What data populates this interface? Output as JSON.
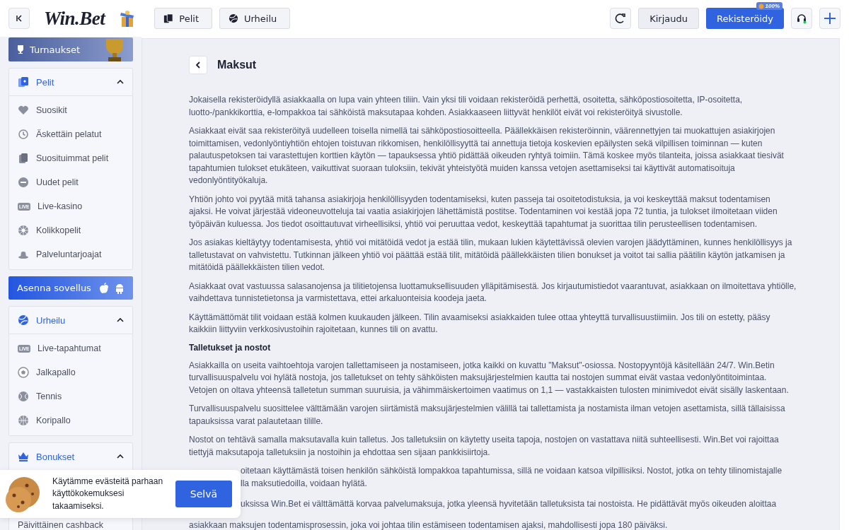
{
  "header": {
    "logo": "Win.Bet",
    "nav": [
      {
        "label": "Pelit"
      },
      {
        "label": "Urheilu"
      }
    ],
    "login": "Kirjaudu",
    "register": "Rekisteröidy",
    "register_badge": "100%"
  },
  "sidebar": {
    "promo": "Turnaukset",
    "sections": [
      {
        "title": "Pelit",
        "expanded": true,
        "items": [
          {
            "label": "Suosikit"
          },
          {
            "label": "Äskettäin pelatut"
          },
          {
            "label": "Suosituimmat pelit"
          },
          {
            "label": "Uudet pelit"
          },
          {
            "label": "Live-kasino",
            "badge": "LIVE"
          },
          {
            "label": "Kolikkopelit"
          },
          {
            "label": "Palveluntarjoajat"
          }
        ]
      },
      {
        "title": "Urheilu",
        "expanded": true,
        "items": [
          {
            "label": "Live-tapahtumat",
            "badge": "LIVE"
          },
          {
            "label": "Jalkapallo"
          },
          {
            "label": "Tennis"
          },
          {
            "label": "Koripallo"
          }
        ]
      },
      {
        "title": "Bonukset",
        "expanded": true,
        "items": [
          {
            "label": "Päivittäinen cashback"
          }
        ]
      }
    ],
    "install": "Asenna sovellus"
  },
  "main": {
    "title": "Maksut",
    "blocks": [
      {
        "kind": "paragraph",
        "text": "Jokaisella rekisteröidyllä asiakkaalla on lupa vain yhteen tiliin. Vain yksi tili voidaan rekisteröidä perhettä, osoitetta, sähköpostiosoitetta, IP-osoitetta, luotto-/pankkikorttia, e-lompakkoa tai sähköistä maksutapaa kohden. Asiakkaaseen liittyvät henkilöt eivät voi rekisteröityä sivustolle."
      },
      {
        "kind": "paragraph",
        "text": "Asiakkaat eivät saa rekisteröityä uudelleen toisella nimellä tai sähköpostiosoitteella. Päällekkäisen rekisteröinnin, väärennettyjen tai muokattujen asiakirjojen toimittamisen, vedonlyöntiyhtiön ehtojen toistuvan rikkomisen, henkilöllisyyttä tai annettuja tietoja koskevien epäilysten sekä vilpillisen toiminnan — kuten palautuspetoksen tai varastettujen korttien käytön — tapauksessa yhtiö pidättää oikeuden ryhtyä toimiin. Tämä koskee myös tilanteita, joissa asiakkaat tiesivät tapahtumien tulokset etukäteen, vaikuttivat suoraan tuloksiin, tekivät yhteistyötä muiden kanssa vetojen asettamiseksi tai käyttivät automatisoituja vedonlyöntityökaluja."
      },
      {
        "kind": "paragraph",
        "text": "Yhtiön johto voi pyytää mitä tahansa asiakirjoja henkilöllisyyden todentamiseksi, kuten passeja tai osoitetodistuksia, ja voi keskeyttää maksut todentamisen ajaksi. He voivat järjestää videoneuvotteluja tai vaatia asiakirjojen lähettämistä postitse. Todentaminen voi kestää jopa 72 tuntia, ja tulokset ilmoitetaan viiden työpäivän kuluessa. Jos tiedot osoittautuvat virheellisiksi, yhtiö voi peruuttaa vedot, keskeyttää tapahtumat ja suorittaa tilin perusteellisen todentamisen."
      },
      {
        "kind": "paragraph",
        "text": "Jos asiakas kieltäytyy todentamisesta, yhtiö voi mitätöidä vedot ja estää tilin, mukaan lukien käytettävissä olevien varojen jäädyttäminen, kunnes henkilöllisyys ja talletustavat on vahvistettu. Tutkinnan jälkeen yhtiö voi päättää estää tilit, mitätöidä päällekkäisten tilien bonukset ja voitot tai sallia päätilin käytön jatkamisen ja mitätöidä päällekkäisten tilien vedot."
      },
      {
        "kind": "paragraph",
        "text": "Asiakkaat ovat vastuussa salasanojensa ja tilitietojensa luottamuksellisuuden ylläpitämisestä. Jos kirjautumistiedot vaarantuvat, asiakkaan on ilmoitettava yhtiölle, vaihdettava tunnistetietonsa ja varmistettava, ettei arkaluonteisia koodeja jaeta."
      },
      {
        "kind": "paragraph",
        "text": "Käyttämättömät tilit voidaan estää kolmen kuukauden jälkeen. Tilin avaamiseksi asiakkaiden tulee ottaa yhteyttä turvallisuustiimiin. Jos tili on estetty, pääsy kaikkiin liittyviin verkkosivustoihin rajoitetaan, kunnes tili on avattu."
      },
      {
        "kind": "heading",
        "text": "Talletukset ja nostot"
      },
      {
        "kind": "paragraph",
        "text": "Asiakkailla on useita vaihtoehtoja varojen tallettamiseen ja nostamiseen, jotka kaikki on kuvattu \"Maksut\"-osiossa. Nostopyyntöjä käsitellään 24/7. Win.Betin turvallisuuspalvelu voi hylätä nostoja, jos talletukset on tehty sähköisten maksujärjestelmien kautta tai nostojen summat eivät vastaa vedonlyöntitoimintaa. Vetojen on oltava yhteensä talletetun summan suuruisia, ja vähimmäiskertoimen vaatimus on 1,1 — vastakkaisten tulosten minimivedot eivät sisälly laskentaan."
      },
      {
        "kind": "paragraph",
        "text": "Turvallisuuspalvelu suosittelee välttämään varojen siirtämistä maksujärjestelmien välillä tai tallettamista ja nostamista ilman vetojen asettamista, sillä tällaisissa tapauksissa varat palautetaan tilille."
      },
      {
        "kind": "paragraph",
        "text": "Nostot on tehtävä samalla maksutavalla kuin talletus. Jos talletuksiin on käytetty useita tapoja, nostojen on vastattava niitä suhteellisesti. Win.Bet voi rajoittaa tiettyjä maksutapoja talletuksiin ja nostoihin ja ehdottaa sen sijaan pankkisiirtoja."
      },
      {
        "kind": "covered",
        "lines": [
          "oitetaan käyttämästä toisen henkilön sähköistä lompakkoa tapahtumissa, sillä ne voidaan katsoa vilpillisiksi. Nostot, jotka on tehty tilinomistajalle",
          "lla maksutiedoilla, voidaan hylätä."
        ]
      },
      {
        "kind": "covered",
        "lines": [
          "uksissa Win.Bet ei välttämättä korvaa palvelumaksuja, jotka yleensä hyvitetään talletuksista tai nostoista. He pidättävät myös oikeuden aloittaa"
        ]
      },
      {
        "kind": "paragraph",
        "text": "asiakkaan maksujen todentamisprosessin, joka voi johtaa tilin estämiseen todentamisen ajaksi, mahdollisesti jopa 180 päiväksi."
      }
    ]
  },
  "cookie": {
    "text": "Käytämme evästeitä parhaan käyttökokemuksesi takaamiseksi.",
    "button": "Selvä"
  }
}
